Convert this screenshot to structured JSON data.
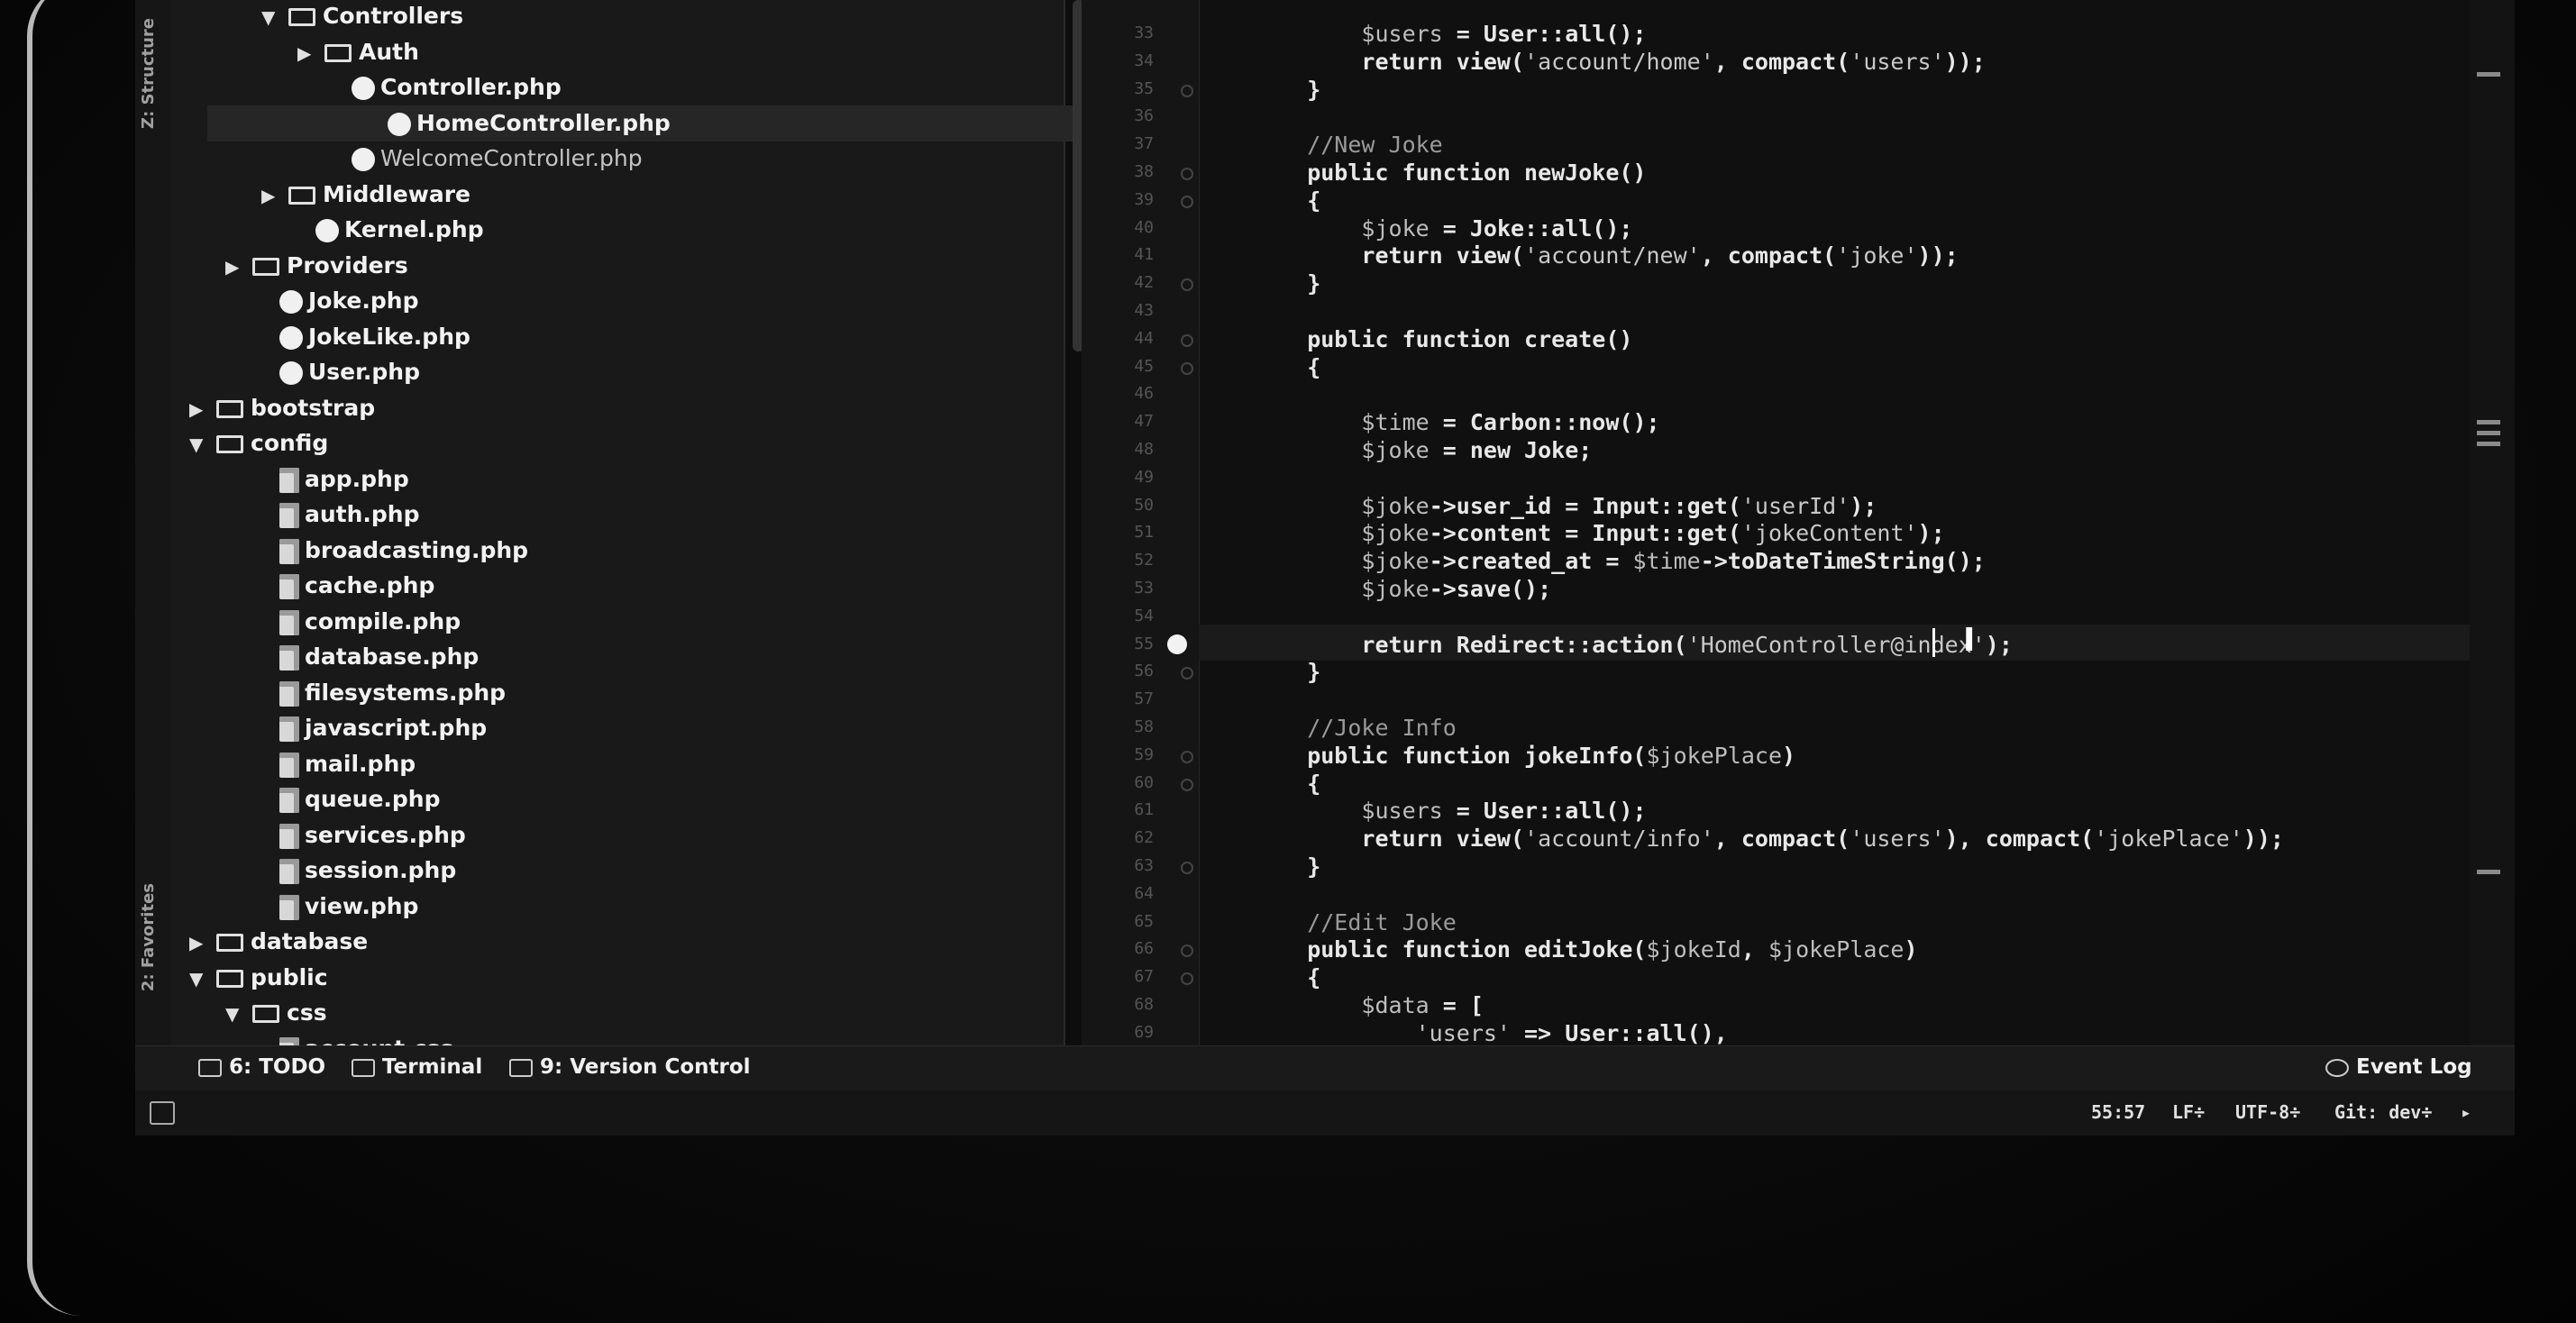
{
  "tool_strip": {
    "structure_tab": "Z: Structure",
    "favorites_tab": "2: Favorites"
  },
  "tree": [
    {
      "label": "Controllers",
      "kind": "folder",
      "expanded": true,
      "indent": 3
    },
    {
      "label": "Auth",
      "kind": "folder",
      "expanded": false,
      "indent": 4
    },
    {
      "label": "Controller.php",
      "kind": "php",
      "indent": 5
    },
    {
      "label": "HomeController.php",
      "kind": "php",
      "indent": 5,
      "selected": true
    },
    {
      "label": "WelcomeController.php",
      "kind": "php",
      "indent": 5,
      "dim": true
    },
    {
      "label": "Middleware",
      "kind": "folder",
      "expanded": false,
      "indent": 3
    },
    {
      "label": "Kernel.php",
      "kind": "php",
      "indent": 4
    },
    {
      "label": "Providers",
      "kind": "folder",
      "expanded": false,
      "indent": 2
    },
    {
      "label": "Joke.php",
      "kind": "php",
      "indent": 3
    },
    {
      "label": "JokeLike.php",
      "kind": "php",
      "indent": 3
    },
    {
      "label": "User.php",
      "kind": "php",
      "indent": 3
    },
    {
      "label": "bootstrap",
      "kind": "folder",
      "expanded": false,
      "indent": 1
    },
    {
      "label": "config",
      "kind": "folder",
      "expanded": true,
      "indent": 1
    },
    {
      "label": "app.php",
      "kind": "doc",
      "indent": 3
    },
    {
      "label": "auth.php",
      "kind": "doc",
      "indent": 3
    },
    {
      "label": "broadcasting.php",
      "kind": "doc",
      "indent": 3
    },
    {
      "label": "cache.php",
      "kind": "doc",
      "indent": 3
    },
    {
      "label": "compile.php",
      "kind": "doc",
      "indent": 3
    },
    {
      "label": "database.php",
      "kind": "doc",
      "indent": 3
    },
    {
      "label": "filesystems.php",
      "kind": "doc",
      "indent": 3
    },
    {
      "label": "javascript.php",
      "kind": "doc",
      "indent": 3
    },
    {
      "label": "mail.php",
      "kind": "doc",
      "indent": 3
    },
    {
      "label": "queue.php",
      "kind": "doc",
      "indent": 3
    },
    {
      "label": "services.php",
      "kind": "doc",
      "indent": 3
    },
    {
      "label": "session.php",
      "kind": "doc",
      "indent": 3
    },
    {
      "label": "view.php",
      "kind": "doc",
      "indent": 3
    },
    {
      "label": "database",
      "kind": "folder",
      "expanded": false,
      "indent": 1
    },
    {
      "label": "public",
      "kind": "folder",
      "expanded": true,
      "indent": 1
    },
    {
      "label": "css",
      "kind": "folder",
      "expanded": true,
      "indent": 2
    },
    {
      "label": "account.css",
      "kind": "doc",
      "indent": 3
    }
  ],
  "code_lines": [
    {
      "n": "33",
      "t": "        $users = User::all();"
    },
    {
      "n": "34",
      "t": "        return view('account/home', compact('users'));"
    },
    {
      "n": "35",
      "t": "    }"
    },
    {
      "n": "36",
      "t": ""
    },
    {
      "n": "37",
      "t": "    //New Joke"
    },
    {
      "n": "38",
      "t": "    public function newJoke()"
    },
    {
      "n": "39",
      "t": "    {"
    },
    {
      "n": "40",
      "t": "        $joke = Joke::all();"
    },
    {
      "n": "41",
      "t": "        return view('account/new', compact('joke'));"
    },
    {
      "n": "42",
      "t": "    }"
    },
    {
      "n": "43",
      "t": ""
    },
    {
      "n": "44",
      "t": "    public function create()"
    },
    {
      "n": "45",
      "t": "    {"
    },
    {
      "n": "46",
      "t": ""
    },
    {
      "n": "47",
      "t": "        $time = Carbon::now();"
    },
    {
      "n": "48",
      "t": "        $joke = new Joke;"
    },
    {
      "n": "49",
      "t": ""
    },
    {
      "n": "50",
      "t": "        $joke->user_id = Input::get('userId');"
    },
    {
      "n": "51",
      "t": "        $joke->content = Input::get('jokeContent');"
    },
    {
      "n": "52",
      "t": "        $joke->created_at = $time->toDateTimeString();"
    },
    {
      "n": "53",
      "t": "        $joke->save();"
    },
    {
      "n": "54",
      "t": ""
    },
    {
      "n": "55",
      "t": "        return Redirect::action('HomeController@index');"
    },
    {
      "n": "56",
      "t": "    }"
    },
    {
      "n": "57",
      "t": ""
    },
    {
      "n": "58",
      "t": "    //Joke Info"
    },
    {
      "n": "59",
      "t": "    public function jokeInfo($jokePlace)"
    },
    {
      "n": "60",
      "t": "    {"
    },
    {
      "n": "61",
      "t": "        $users = User::all();"
    },
    {
      "n": "62",
      "t": "        return view('account/info', compact('users'), compact('jokePlace'));"
    },
    {
      "n": "63",
      "t": "    }"
    },
    {
      "n": "64",
      "t": ""
    },
    {
      "n": "65",
      "t": "    //Edit Joke"
    },
    {
      "n": "66",
      "t": "    public function editJoke($jokeId, $jokePlace)"
    },
    {
      "n": "67",
      "t": "    {"
    },
    {
      "n": "68",
      "t": "        $data = ["
    },
    {
      "n": "69",
      "t": "            'users' => User::all(),"
    }
  ],
  "bottom_bar": {
    "todo": "6: TODO",
    "terminal": "Terminal",
    "version_control": "9: Version Control",
    "event_log": "Event Log"
  },
  "status_bar": {
    "position": "55:57",
    "line_sep": "LF÷",
    "encoding": "UTF-8÷",
    "git": "Git: dev÷"
  }
}
